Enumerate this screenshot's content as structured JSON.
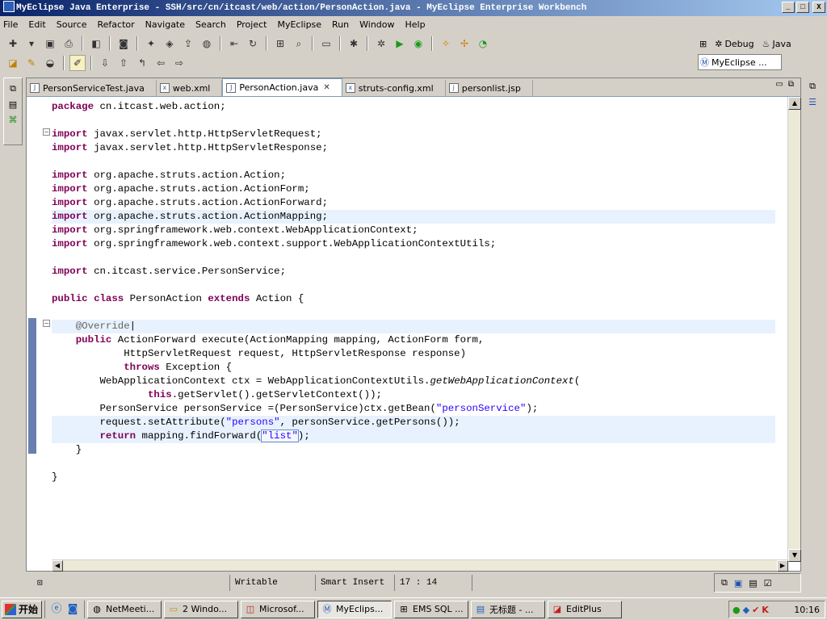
{
  "window": {
    "title": "MyEclipse Java Enterprise - SSH/src/cn/itcast/web/action/PersonAction.java - MyEclipse Enterprise Workbench",
    "controls": [
      "_",
      "□",
      "X"
    ]
  },
  "menubar": {
    "items": [
      "File",
      "Edit",
      "Source",
      "Refactor",
      "Navigate",
      "Search",
      "Project",
      "MyEclipse",
      "Run",
      "Window",
      "Help"
    ]
  },
  "perspectives": {
    "debug": "Debug",
    "java": "Java",
    "active": "MyEclipse ..."
  },
  "editor": {
    "tabs": [
      {
        "label": "PersonServiceTest.java",
        "icon": "J"
      },
      {
        "label": "web.xml",
        "icon": "x"
      },
      {
        "label": "PersonAction.java",
        "icon": "J",
        "active": true
      },
      {
        "label": "struts-config.xml",
        "icon": "x"
      },
      {
        "label": "personlist.jsp",
        "icon": "j"
      }
    ]
  },
  "code": [
    "package cn.itcast.web.action;",
    "",
    "import javax.servlet.http.HttpServletRequest;",
    "import javax.servlet.http.HttpServletResponse;",
    "",
    "import org.apache.struts.action.Action;",
    "import org.apache.struts.action.ActionForm;",
    "import org.apache.struts.action.ActionForward;",
    "import org.apache.struts.action.ActionMapping;",
    "import org.springframework.web.context.WebApplicationContext;",
    "import org.springframework.web.context.support.WebApplicationContextUtils;",
    "",
    "import cn.itcast.service.PersonService;",
    "",
    "public class PersonAction extends Action {",
    "",
    "    @Override",
    "    public ActionForward execute(ActionMapping mapping, ActionForm form,",
    "            HttpServletRequest request, HttpServletResponse response)",
    "            throws Exception {",
    "        WebApplicationContext ctx = WebApplicationContextUtils.getWebApplicationContext(",
    "                this.getServlet().getServletContext());",
    "        PersonService personService =(PersonService)ctx.getBean(\"personService\");",
    "        request.setAttribute(\"persons\", personService.getPersons());",
    "        return mapping.findForward(\"list\");",
    "    }",
    "",
    "}"
  ],
  "status": {
    "writable": "Writable",
    "insert_mode": "Smart Insert",
    "position": "17 : 14"
  },
  "taskbar": {
    "start": "开始",
    "tasks": [
      "NetMeeti...",
      "2 Windo...",
      "Microsof...",
      "MyEclips...",
      "EMS SQL ...",
      "无标题 - ...",
      "EditPlus"
    ],
    "clock": "10:16"
  }
}
